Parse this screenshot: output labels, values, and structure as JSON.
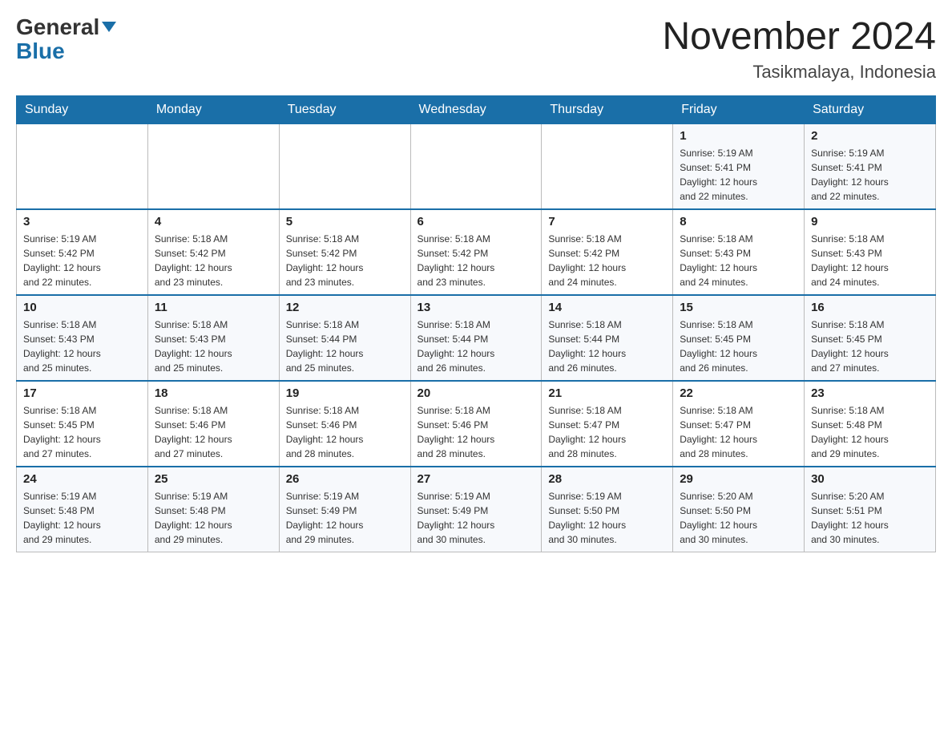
{
  "logo": {
    "part1": "General",
    "part2": "Blue"
  },
  "title": "November 2024",
  "subtitle": "Tasikmalaya, Indonesia",
  "days_of_week": [
    "Sunday",
    "Monday",
    "Tuesday",
    "Wednesday",
    "Thursday",
    "Friday",
    "Saturday"
  ],
  "weeks": [
    [
      {
        "day": "",
        "info": ""
      },
      {
        "day": "",
        "info": ""
      },
      {
        "day": "",
        "info": ""
      },
      {
        "day": "",
        "info": ""
      },
      {
        "day": "",
        "info": ""
      },
      {
        "day": "1",
        "info": "Sunrise: 5:19 AM\nSunset: 5:41 PM\nDaylight: 12 hours\nand 22 minutes."
      },
      {
        "day": "2",
        "info": "Sunrise: 5:19 AM\nSunset: 5:41 PM\nDaylight: 12 hours\nand 22 minutes."
      }
    ],
    [
      {
        "day": "3",
        "info": "Sunrise: 5:19 AM\nSunset: 5:42 PM\nDaylight: 12 hours\nand 22 minutes."
      },
      {
        "day": "4",
        "info": "Sunrise: 5:18 AM\nSunset: 5:42 PM\nDaylight: 12 hours\nand 23 minutes."
      },
      {
        "day": "5",
        "info": "Sunrise: 5:18 AM\nSunset: 5:42 PM\nDaylight: 12 hours\nand 23 minutes."
      },
      {
        "day": "6",
        "info": "Sunrise: 5:18 AM\nSunset: 5:42 PM\nDaylight: 12 hours\nand 23 minutes."
      },
      {
        "day": "7",
        "info": "Sunrise: 5:18 AM\nSunset: 5:42 PM\nDaylight: 12 hours\nand 24 minutes."
      },
      {
        "day": "8",
        "info": "Sunrise: 5:18 AM\nSunset: 5:43 PM\nDaylight: 12 hours\nand 24 minutes."
      },
      {
        "day": "9",
        "info": "Sunrise: 5:18 AM\nSunset: 5:43 PM\nDaylight: 12 hours\nand 24 minutes."
      }
    ],
    [
      {
        "day": "10",
        "info": "Sunrise: 5:18 AM\nSunset: 5:43 PM\nDaylight: 12 hours\nand 25 minutes."
      },
      {
        "day": "11",
        "info": "Sunrise: 5:18 AM\nSunset: 5:43 PM\nDaylight: 12 hours\nand 25 minutes."
      },
      {
        "day": "12",
        "info": "Sunrise: 5:18 AM\nSunset: 5:44 PM\nDaylight: 12 hours\nand 25 minutes."
      },
      {
        "day": "13",
        "info": "Sunrise: 5:18 AM\nSunset: 5:44 PM\nDaylight: 12 hours\nand 26 minutes."
      },
      {
        "day": "14",
        "info": "Sunrise: 5:18 AM\nSunset: 5:44 PM\nDaylight: 12 hours\nand 26 minutes."
      },
      {
        "day": "15",
        "info": "Sunrise: 5:18 AM\nSunset: 5:45 PM\nDaylight: 12 hours\nand 26 minutes."
      },
      {
        "day": "16",
        "info": "Sunrise: 5:18 AM\nSunset: 5:45 PM\nDaylight: 12 hours\nand 27 minutes."
      }
    ],
    [
      {
        "day": "17",
        "info": "Sunrise: 5:18 AM\nSunset: 5:45 PM\nDaylight: 12 hours\nand 27 minutes."
      },
      {
        "day": "18",
        "info": "Sunrise: 5:18 AM\nSunset: 5:46 PM\nDaylight: 12 hours\nand 27 minutes."
      },
      {
        "day": "19",
        "info": "Sunrise: 5:18 AM\nSunset: 5:46 PM\nDaylight: 12 hours\nand 28 minutes."
      },
      {
        "day": "20",
        "info": "Sunrise: 5:18 AM\nSunset: 5:46 PM\nDaylight: 12 hours\nand 28 minutes."
      },
      {
        "day": "21",
        "info": "Sunrise: 5:18 AM\nSunset: 5:47 PM\nDaylight: 12 hours\nand 28 minutes."
      },
      {
        "day": "22",
        "info": "Sunrise: 5:18 AM\nSunset: 5:47 PM\nDaylight: 12 hours\nand 28 minutes."
      },
      {
        "day": "23",
        "info": "Sunrise: 5:18 AM\nSunset: 5:48 PM\nDaylight: 12 hours\nand 29 minutes."
      }
    ],
    [
      {
        "day": "24",
        "info": "Sunrise: 5:19 AM\nSunset: 5:48 PM\nDaylight: 12 hours\nand 29 minutes."
      },
      {
        "day": "25",
        "info": "Sunrise: 5:19 AM\nSunset: 5:48 PM\nDaylight: 12 hours\nand 29 minutes."
      },
      {
        "day": "26",
        "info": "Sunrise: 5:19 AM\nSunset: 5:49 PM\nDaylight: 12 hours\nand 29 minutes."
      },
      {
        "day": "27",
        "info": "Sunrise: 5:19 AM\nSunset: 5:49 PM\nDaylight: 12 hours\nand 30 minutes."
      },
      {
        "day": "28",
        "info": "Sunrise: 5:19 AM\nSunset: 5:50 PM\nDaylight: 12 hours\nand 30 minutes."
      },
      {
        "day": "29",
        "info": "Sunrise: 5:20 AM\nSunset: 5:50 PM\nDaylight: 12 hours\nand 30 minutes."
      },
      {
        "day": "30",
        "info": "Sunrise: 5:20 AM\nSunset: 5:51 PM\nDaylight: 12 hours\nand 30 minutes."
      }
    ]
  ]
}
